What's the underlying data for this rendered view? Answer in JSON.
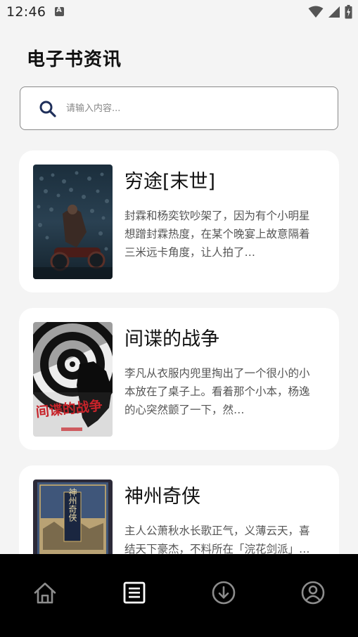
{
  "status": {
    "time": "12:46"
  },
  "header": {
    "title": "电子书资讯"
  },
  "search": {
    "placeholder": "请输入内容..."
  },
  "books": [
    {
      "title": "穷途[末世]",
      "description": "封霖和杨奕钦吵架了，因为有个小明星想蹭封霖热度，在某个晚宴上故意隔着三米远卡角度，让人拍了…"
    },
    {
      "title": "间谍的战争",
      "description": "李凡从衣服内兜里掏出了一个很小的小本放在了桌子上。看着那个小本，杨逸的心突然颤了一下，然…",
      "cover_text": "间谍的战争"
    },
    {
      "title": "神州奇侠",
      "description": "主人公萧秋水长歌正气，义薄云天，喜结天下豪杰，不料所在「浣花剑派」…",
      "cover_text": "神州奇侠"
    }
  ],
  "nav": {
    "items": [
      {
        "icon": "home-icon",
        "active": false
      },
      {
        "icon": "article-list-icon",
        "active": true
      },
      {
        "icon": "download-icon",
        "active": false
      },
      {
        "icon": "profile-icon",
        "active": false
      }
    ]
  },
  "colors": {
    "background": "#f4f4f4",
    "nav_background": "#000000",
    "nav_active": "#ffffff",
    "nav_inactive": "#8c8c8c",
    "search_icon": "#1f2f5a"
  }
}
